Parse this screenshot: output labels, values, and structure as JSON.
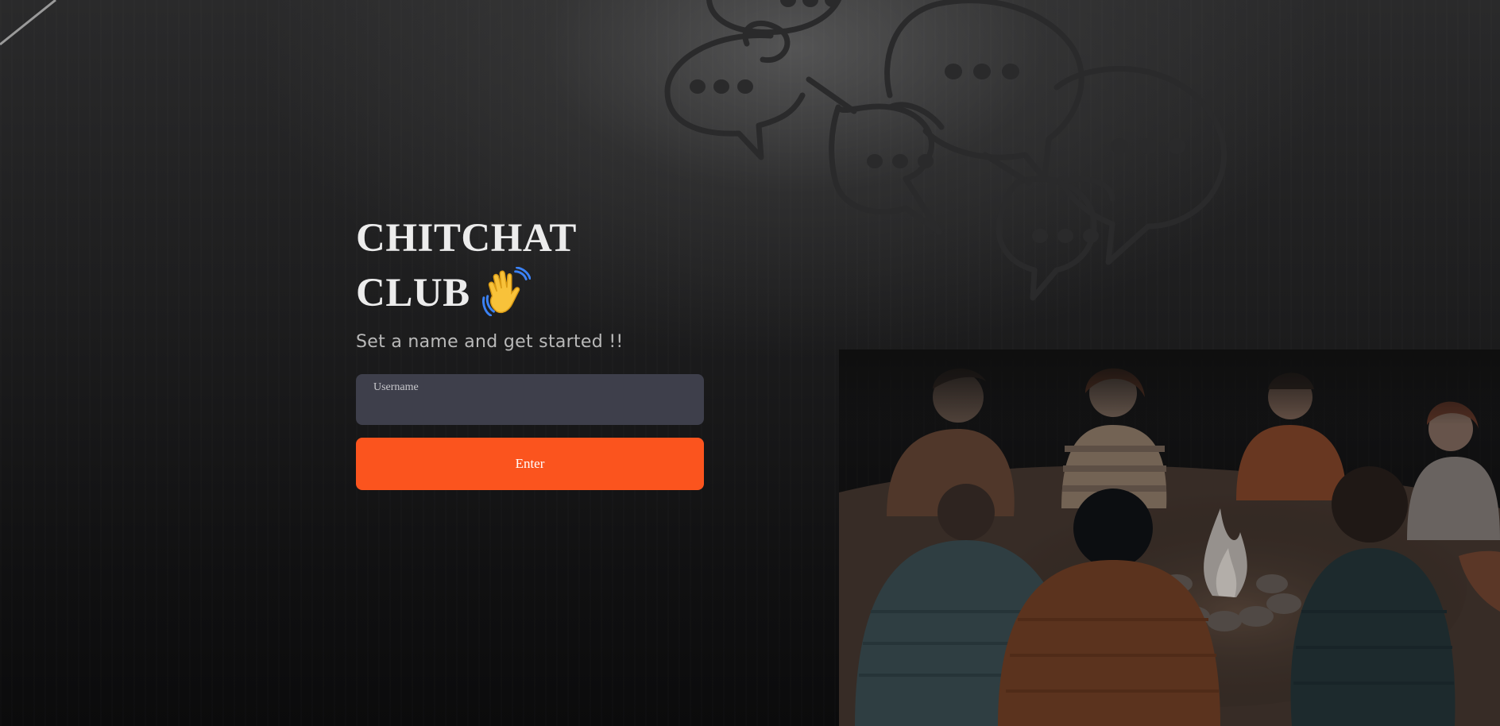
{
  "app": {
    "title_line1": "CHITCHAT",
    "title_line2": "CLUB",
    "wave_icon": "waving-hand-icon",
    "subtitle": "Set a name and get started !!"
  },
  "form": {
    "username_label": "Username",
    "username_value": "",
    "enter_label": "Enter"
  },
  "colors": {
    "button": "#fb541e",
    "field": "#3e3f4b",
    "title": "#ececec"
  }
}
